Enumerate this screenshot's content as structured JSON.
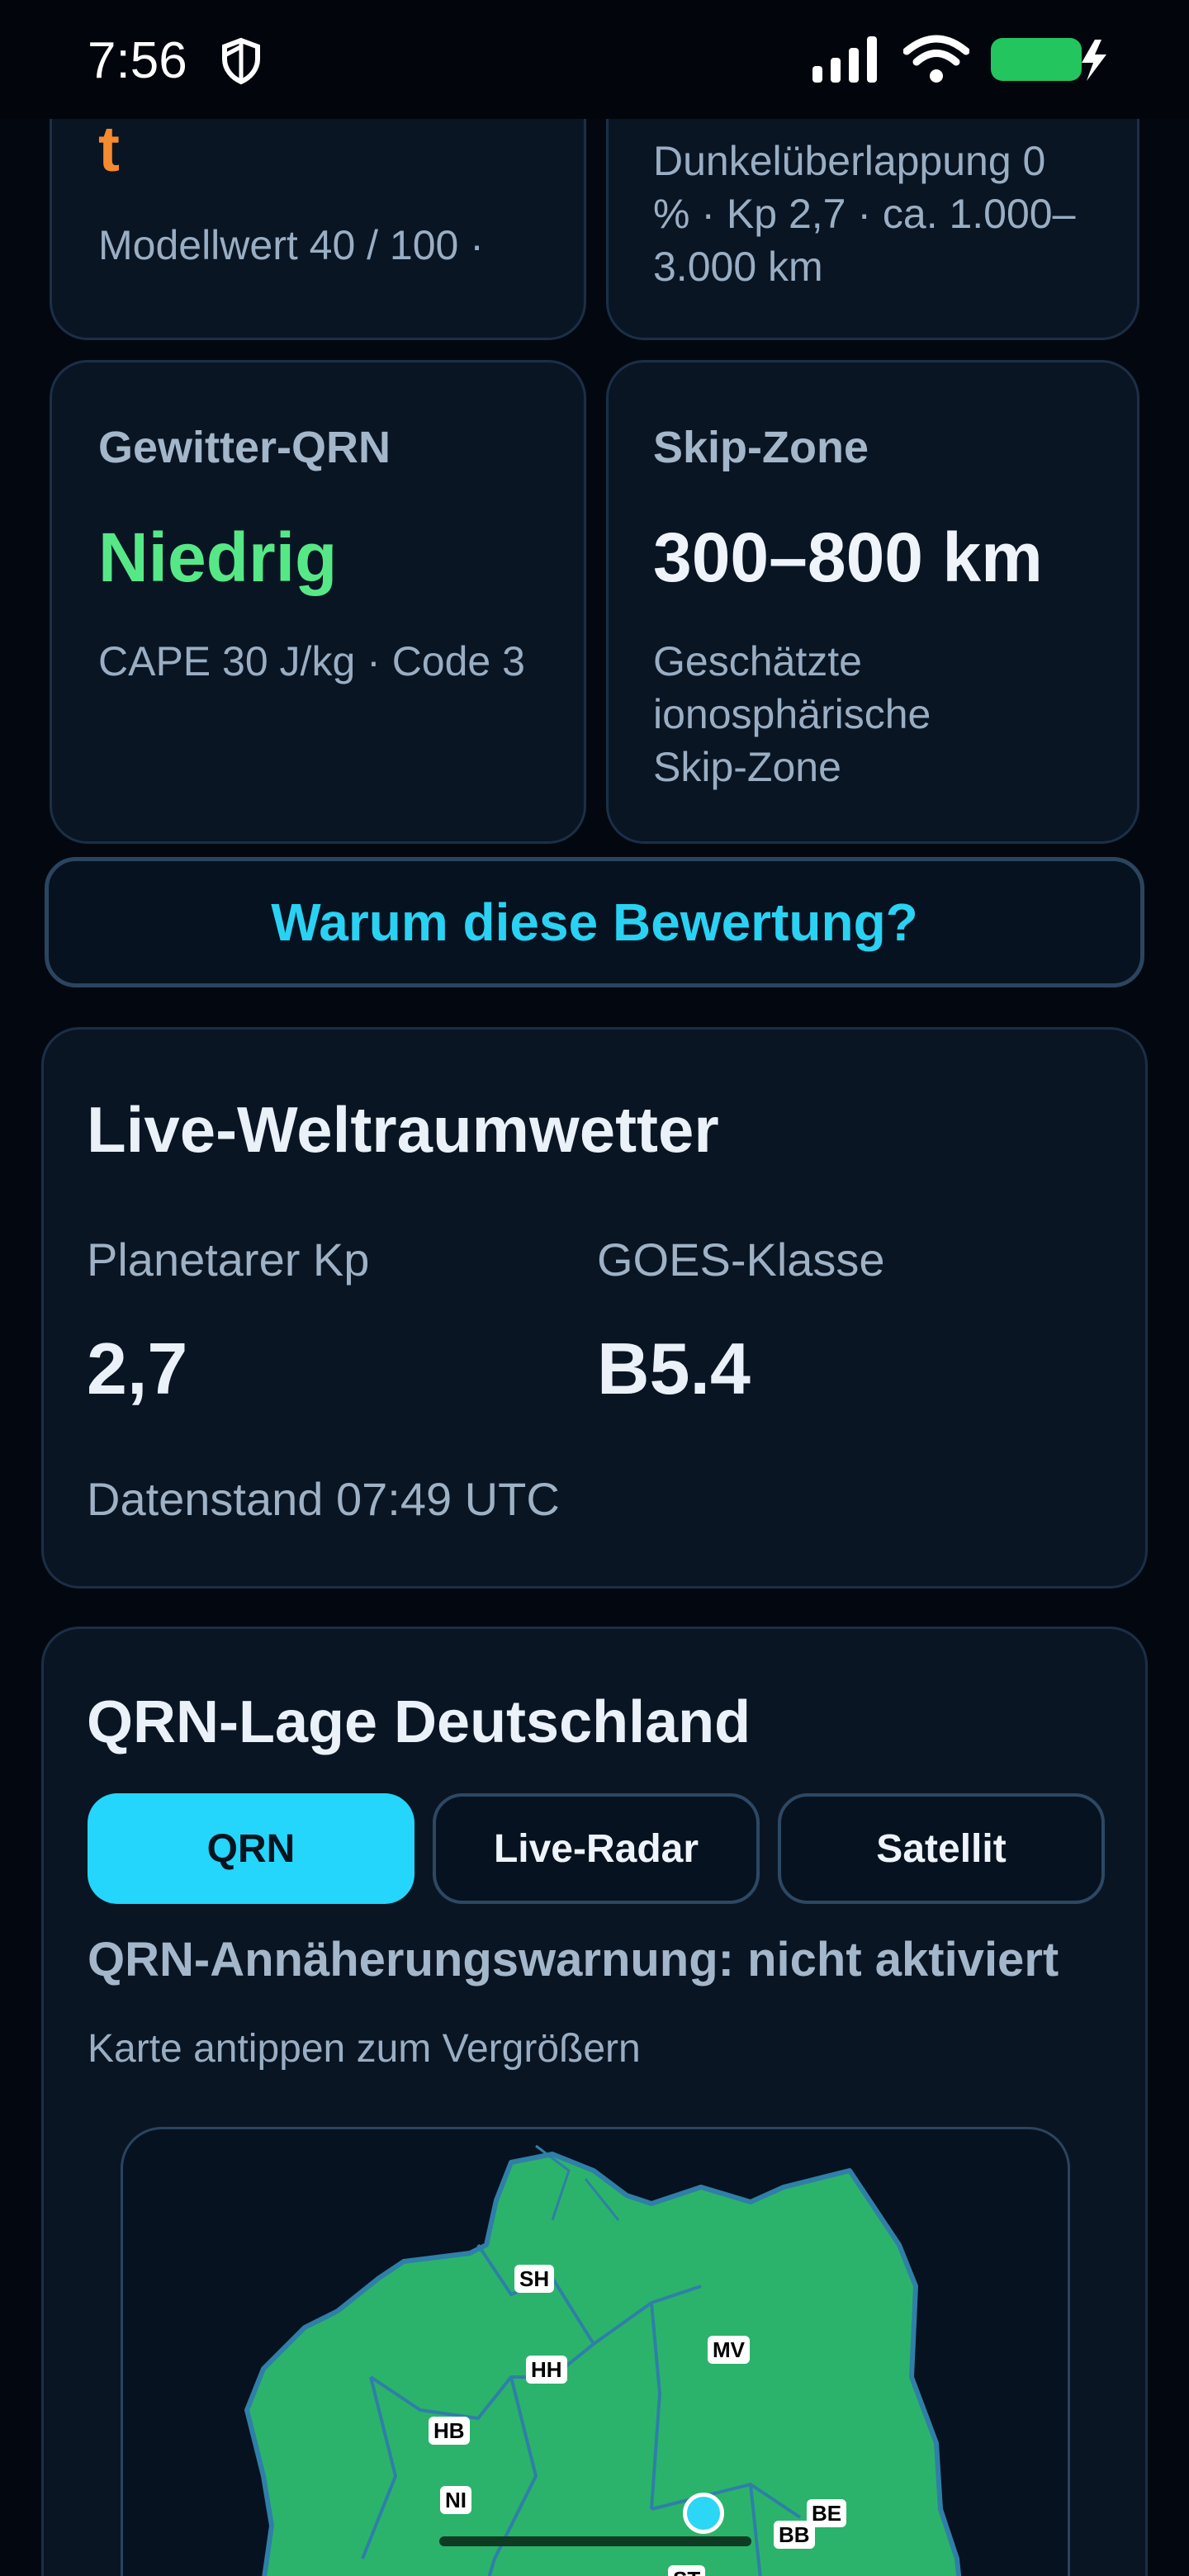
{
  "status_bar": {
    "time": "7:56"
  },
  "tiles": [
    {
      "value": "t",
      "sub": "Modellwert 40 / 100 ·",
      "value_color": "#f58a2e"
    },
    {
      "sub": "Dunkelüberlappung 0 % · Kp 2,7 · ca. 1.000–3.000 km"
    },
    {
      "label": "Gewitter-QRN",
      "value": "Niedrig",
      "sub": "CAPE 30 J/kg · Code 3",
      "value_color": "#56e887"
    },
    {
      "label": "Skip-Zone",
      "value": "300–800 km",
      "sub": "Geschätzte ionosphärische Skip-Zone",
      "value_color": "#eef4fa"
    }
  ],
  "why_button": {
    "label": "Warum diese Bewertung?"
  },
  "space_weather": {
    "title": "Live-Weltraumwetter",
    "kp_label": "Planetarer Kp",
    "kp_value": "2,7",
    "goes_label": "GOES-Klasse",
    "goes_value": "B5.4",
    "timestamp": "Datenstand 07:49 UTC"
  },
  "qrn": {
    "title": "QRN-Lage Deutschland",
    "tabs": [
      {
        "label": "QRN",
        "active": true
      },
      {
        "label": "Live-Radar",
        "active": false
      },
      {
        "label": "Satellit",
        "active": false
      }
    ],
    "warning": "QRN-Annäherungswarnung: nicht aktiviert",
    "hint": "Karte antippen zum Vergrößern",
    "map_states": [
      "SH",
      "HH",
      "MV",
      "HB",
      "NI",
      "BE",
      "BB",
      "ST"
    ]
  },
  "colors": {
    "accent": "#24d6fb",
    "map_land": "#2bb36b",
    "map_border": "#2f7fa8"
  }
}
